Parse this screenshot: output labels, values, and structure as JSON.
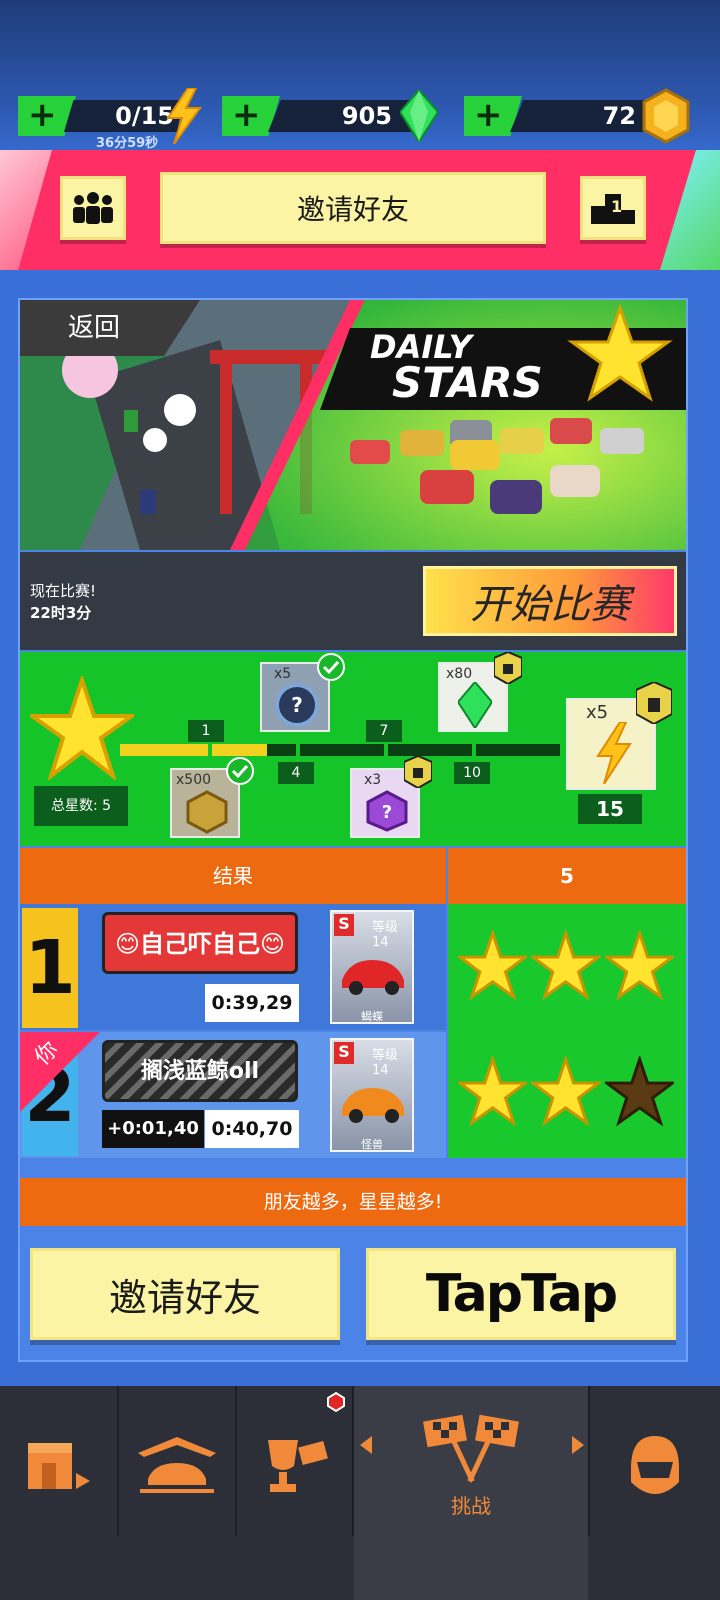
{
  "resources": {
    "energy": {
      "value": "0/15",
      "timer": "36分59秒",
      "plus": "+"
    },
    "gems": {
      "value": "905",
      "plus": "+"
    },
    "coins": {
      "value": "72",
      "plus": "+"
    }
  },
  "banner": {
    "invite_label": "邀请好友",
    "podium_number": "1"
  },
  "event": {
    "back_label": "返回",
    "title_line1": "DAILY",
    "title_line2": "STARS",
    "status_line1": "现在比赛!",
    "status_line2": "22时3分",
    "start_label": "开始比赛"
  },
  "progress": {
    "total_stars_label": "总星数: 5",
    "current_stars": 5,
    "max_stars": 15,
    "milestones": [
      "1",
      "4",
      "7",
      "10",
      "15"
    ],
    "rewards": [
      {
        "qty": "x500",
        "icon": "coin-icon",
        "claimed": true
      },
      {
        "qty": "x5",
        "icon": "mystery-tire-icon",
        "claimed": true
      },
      {
        "qty": "x3",
        "icon": "mystery-box-icon",
        "locked": true
      },
      {
        "qty": "x80",
        "icon": "gem-icon",
        "locked": true
      },
      {
        "qty": "x5",
        "icon": "energy-icon",
        "locked": true
      }
    ]
  },
  "results": {
    "header": "结果",
    "stars_header": "5",
    "rows": [
      {
        "rank": "1",
        "name": "😊自己吓自己😊",
        "time": "0:39,29",
        "car_class": "S",
        "car_level": "等级14",
        "car_name": "蝎蝶",
        "stars": 3
      },
      {
        "rank": "2",
        "you": "你",
        "name": "搁浅蓝鲸oll",
        "delta": "+0:01,40",
        "time": "0:40,70",
        "car_class": "S",
        "car_level": "等级14",
        "car_name": "怪兽",
        "stars": 2
      }
    ]
  },
  "footer": {
    "tip": "朋友越多，星星越多!",
    "invite_label": "邀请好友",
    "taptap_label": "TapTap"
  },
  "nav": {
    "items": [
      "shop-icon",
      "garage-icon",
      "trophy-icon",
      "challenge-icon",
      "helmet-icon"
    ],
    "active_label": "挑战"
  },
  "colors": {
    "accent_pink": "#ff2e64",
    "green": "#15c428",
    "orange": "#ee6a10",
    "button_yellow": "#faf4a4"
  }
}
